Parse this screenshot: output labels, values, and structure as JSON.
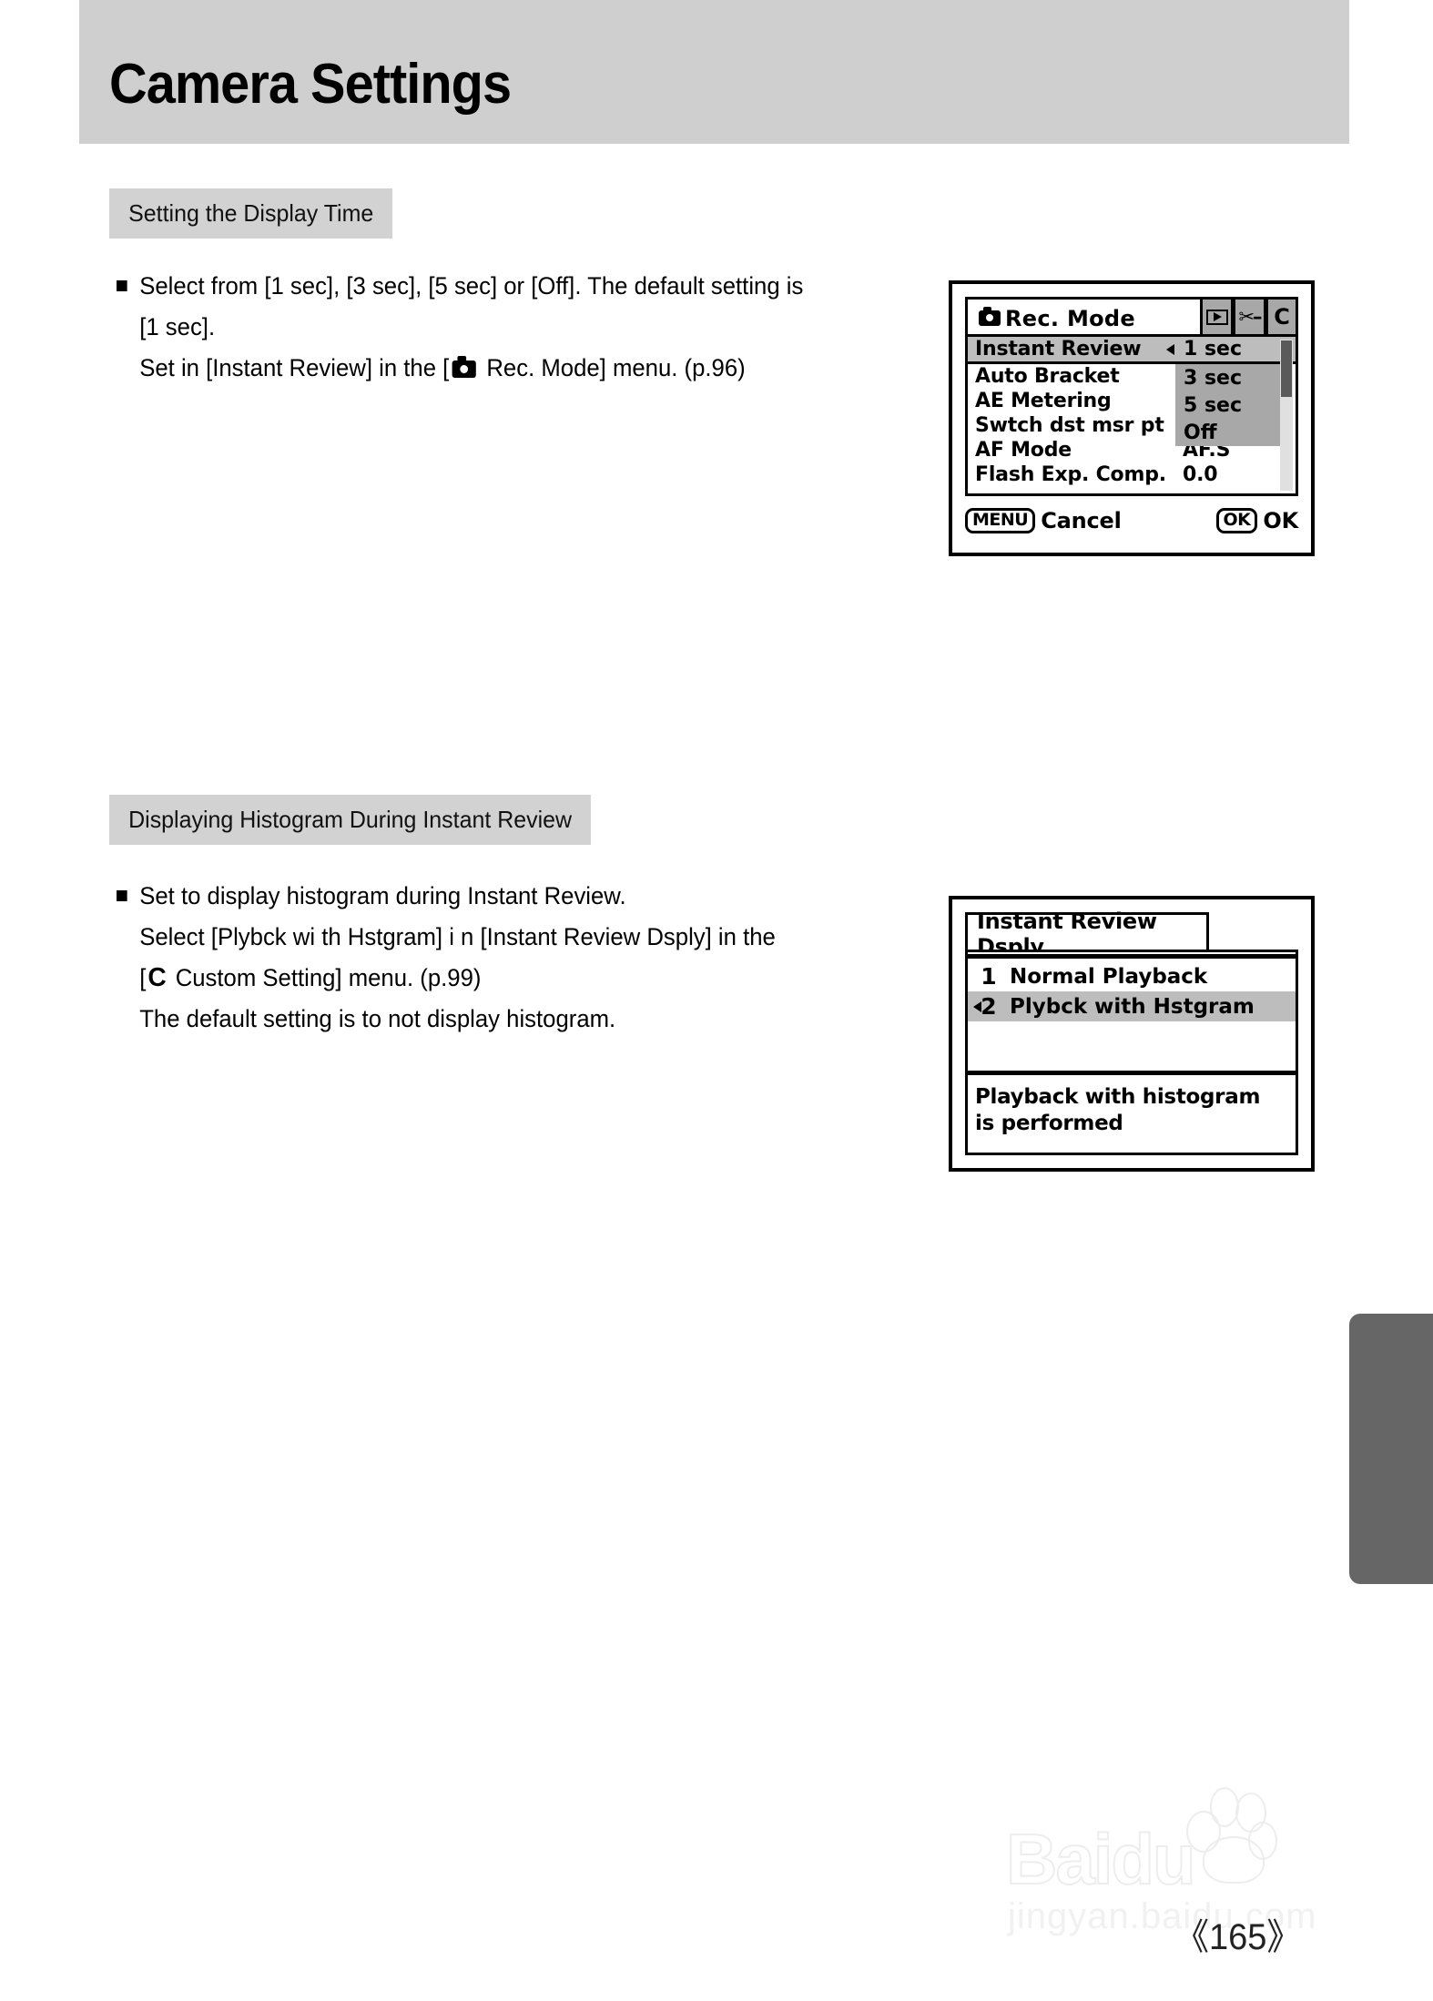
{
  "page": {
    "title": "Camera Settings",
    "number": "《165》"
  },
  "sections": [
    {
      "chip_label": "Setting the Display Time",
      "lines": [
        "Select from [1 sec], [3 sec], [5 sec] or [Off]. The default setting is",
        "[1 sec].",
        "Set in [Instant Review] in the [",
        " Rec. Mode] menu. (p.96)"
      ]
    },
    {
      "chip_label": "Displaying Histogram During Instant Review",
      "lines": [
        "Set to display histogram during Instant Review.",
        "Select [Plybck wi th Hstgram] i n [Instant Review Dsply] in the",
        "[",
        "C",
        " Custom Setting] menu. (p.99)",
        "The default setting is to not display histogram."
      ]
    }
  ],
  "lcd_rec_mode": {
    "title": "Rec. Mode",
    "title_icon": "camera-icon",
    "tabs": [
      {
        "name": "playback-tab",
        "glyph": "play-icon"
      },
      {
        "name": "setup-tab",
        "glyph": "wrench-icon"
      },
      {
        "name": "custom-tab",
        "glyph": "C"
      }
    ],
    "menu_items": [
      {
        "label": "Instant Review",
        "value": "1 sec",
        "selected": true
      },
      {
        "label": "Auto Bracket",
        "value": "",
        "selected": false
      },
      {
        "label": "AE Metering",
        "value": "",
        "selected": false
      },
      {
        "label": "Swtch dst msr pt",
        "value": "",
        "selected": false
      },
      {
        "label": "AF Mode",
        "value": "AF.S",
        "selected": false
      },
      {
        "label": "Flash Exp. Comp.",
        "value": "0.0",
        "selected": false
      }
    ],
    "dropdown_options": [
      "1 sec",
      "3 sec",
      "5 sec",
      "Off"
    ],
    "dropdown_selected": "1 sec",
    "footer": {
      "left_key": "MENU",
      "left_label": "Cancel",
      "right_key": "OK",
      "right_label": "OK"
    }
  },
  "lcd_instant_review_dsply": {
    "title": "Instant Review Dsply",
    "options": [
      {
        "num": "1",
        "label": "Normal Playback",
        "selected": false
      },
      {
        "num": "2",
        "label": "Plybck with Hstgram",
        "selected": true
      }
    ],
    "description_lines": [
      "Playback with histogram",
      "is performed"
    ]
  },
  "watermark": {
    "main": "Baidu",
    "sub": "jingyan.baidu.com"
  },
  "colors": {
    "header_band": "#cfcfcf",
    "chip": "#d2d2d2",
    "lcd_selected": "#bdbdbd",
    "lcd_dropdown": "#a8a8a8",
    "edge_tab": "#666666"
  }
}
